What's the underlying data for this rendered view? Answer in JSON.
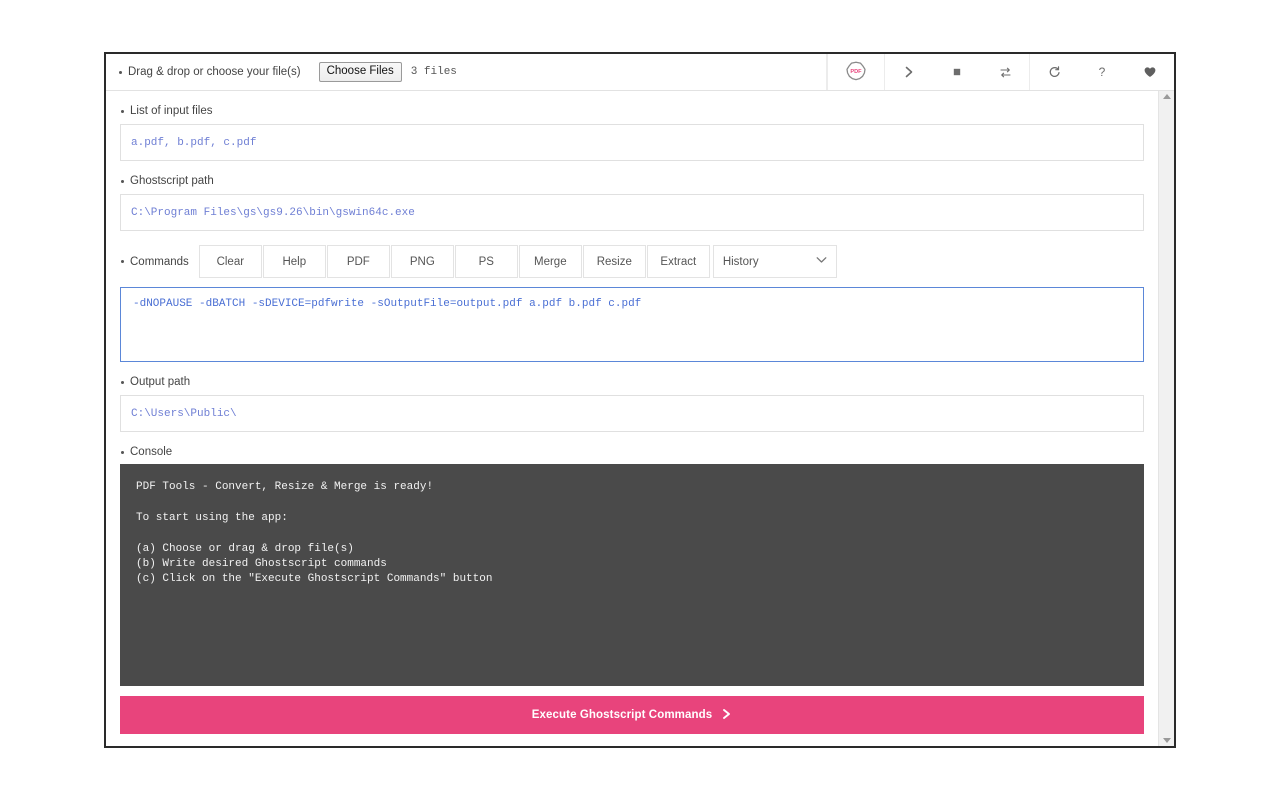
{
  "topbar": {
    "drag_drop_label": "Drag & drop or choose your file(s)",
    "choose_files_label": "Choose Files",
    "files_count": "3 files",
    "brand_text": "PDF",
    "icons": [
      {
        "name": "pdf-brand-icon",
        "glyph": "PDF"
      },
      {
        "name": "run-chevron-icon",
        "glyph": "❯"
      },
      {
        "name": "stop-square-icon",
        "glyph": "■"
      },
      {
        "name": "repeat-loop-icon",
        "glyph": "⇄"
      },
      {
        "name": "refresh-icon",
        "glyph": "↻"
      },
      {
        "name": "help-question-icon",
        "glyph": "?"
      },
      {
        "name": "heart-icon",
        "glyph": "♥"
      }
    ]
  },
  "input_files": {
    "label": "List of input files",
    "value": "a.pdf, b.pdf, c.pdf"
  },
  "ghostscript_path": {
    "label": "Ghostscript path",
    "value": "C:\\Program Files\\gs\\gs9.26\\bin\\gswin64c.exe"
  },
  "commands": {
    "label": "Commands",
    "buttons": [
      "Clear",
      "Help",
      "PDF",
      "PNG",
      "PS",
      "Merge",
      "Resize",
      "Extract"
    ],
    "history_selected": "History",
    "history_options": [
      "History"
    ],
    "chevron": "⌄",
    "textarea_value": "-dNOPAUSE -dBATCH -sDEVICE=pdfwrite -sOutputFile=output.pdf a.pdf b.pdf c.pdf"
  },
  "output_path": {
    "label": "Output path",
    "value": "C:\\Users\\Public\\"
  },
  "console": {
    "label": "Console",
    "lines": [
      "PDF Tools - Convert, Resize & Merge is ready!",
      "",
      "To start using the app:",
      "",
      "(a) Choose or drag & drop file(s)",
      "(b) Write desired Ghostscript commands",
      "(c) Click on the \"Execute Ghostscript Commands\" button"
    ]
  },
  "execute": {
    "label": "Execute Ghostscript Commands",
    "arrow": "❯",
    "color": "#e8447c"
  },
  "colors": {
    "accent_pink": "#e8447c",
    "console_bg": "#4a4a4a",
    "field_text_blue": "#6f7fd4",
    "focus_border": "#5b87d8"
  }
}
